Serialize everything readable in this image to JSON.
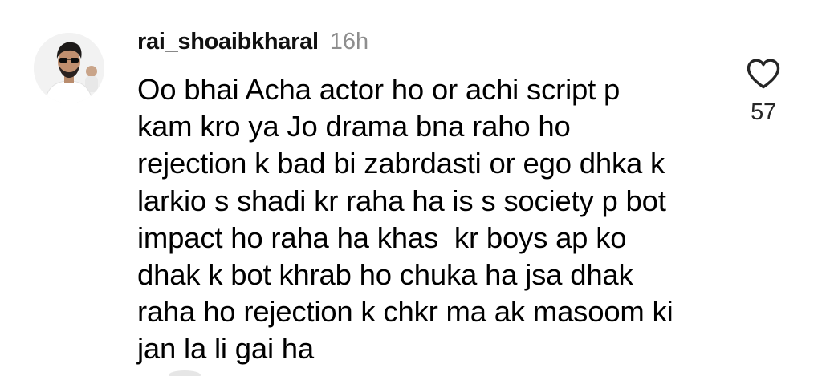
{
  "comment": {
    "username": "rai_shoaibkharal",
    "timestamp": "16h",
    "lines": [
      "Oo bhai Acha actor ho or achi script p",
      "kam kro ya Jo drama bna raho ho",
      "rejection k bad bi zabrdasti or ego dhka k",
      "larkio s shadi kr raha ha is s society p bot",
      "impact ho raha ha khas  kr boys ap ko",
      "dhak k bot khrab ho chuka ha jsa dhak",
      "raha ho rejection k chkr ma ak masoom ki",
      "jan la li gai ha"
    ],
    "like_count": "57",
    "like_icon": "heart-outline-icon"
  },
  "colors": {
    "text": "#000000",
    "muted": "#8e8e8e",
    "icon_stroke": "#262626",
    "background": "#ffffff"
  }
}
